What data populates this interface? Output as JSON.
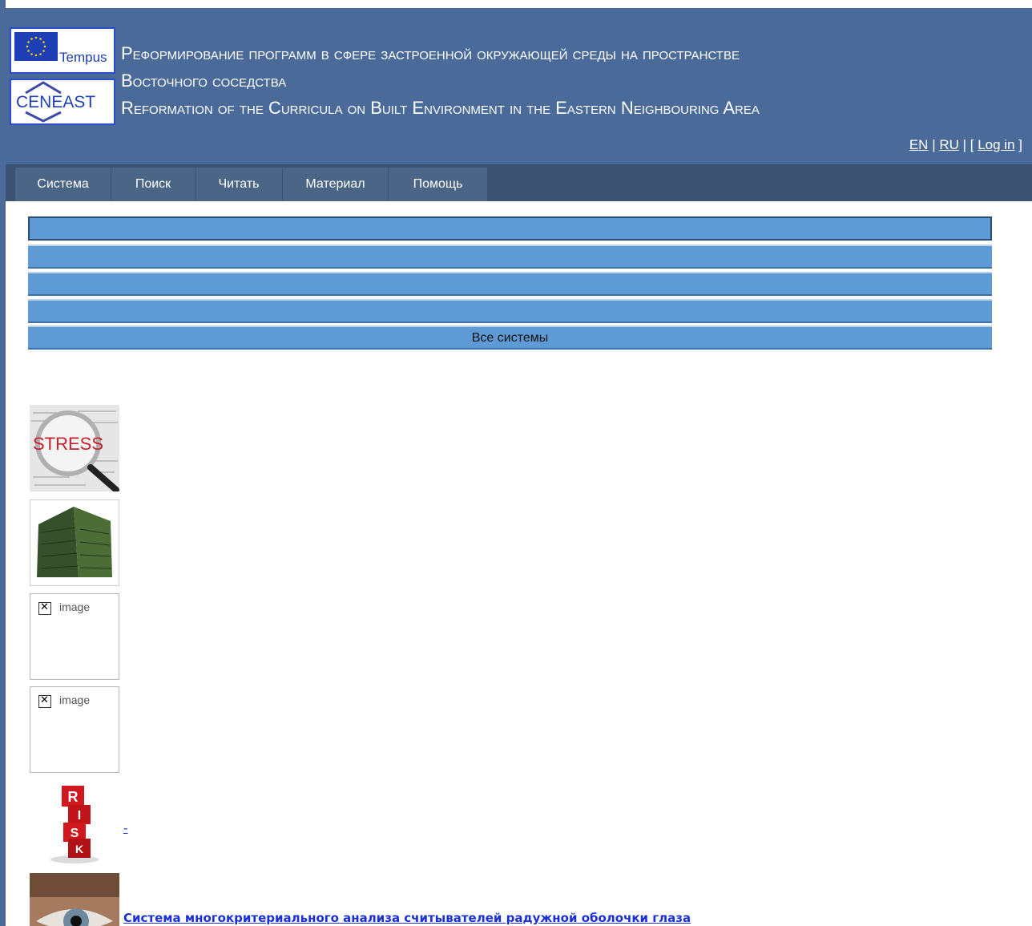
{
  "header": {
    "logos": {
      "tempus_label": "Tempus",
      "ceneast_label": "CENEAST"
    },
    "title_ru_line1": "Реформирование программ в сфере застроенной окружающей среды на пространстве",
    "title_ru_line2": "Восточного соседства",
    "title_en": "Reformation of the Curricula on Built Environment in the Eastern Neighbouring Area",
    "lang": {
      "en": "EN",
      "sep1": " | ",
      "ru": "RU",
      "sep2": " | [ ",
      "login": "Log in",
      "end": " ]"
    }
  },
  "nav": {
    "items": [
      {
        "label": "Система"
      },
      {
        "label": "Поиск"
      },
      {
        "label": "Читать"
      },
      {
        "label": "Материал"
      },
      {
        "label": "Помощь"
      }
    ]
  },
  "filter_bars": {
    "bars": [
      "",
      "",
      "",
      "",
      "Все системы"
    ]
  },
  "list": {
    "items": [
      {
        "image": "stress-magnifier",
        "alt": "",
        "link": ""
      },
      {
        "image": "building",
        "alt": "",
        "link": ""
      },
      {
        "image": "broken",
        "alt": "image",
        "link": ""
      },
      {
        "image": "broken",
        "alt": "image",
        "link": ""
      },
      {
        "image": "risk-cubes",
        "alt": "",
        "link": "-"
      },
      {
        "image": "eye",
        "alt": "",
        "link": "Система многокритериального анализа считывателей радужной оболочки глаза"
      }
    ]
  },
  "colors": {
    "header_bg": "#4a6b9a",
    "nav_bg": "#3b5272",
    "bar_bg": "#5e9ad6",
    "link": "#1a2fd6"
  }
}
